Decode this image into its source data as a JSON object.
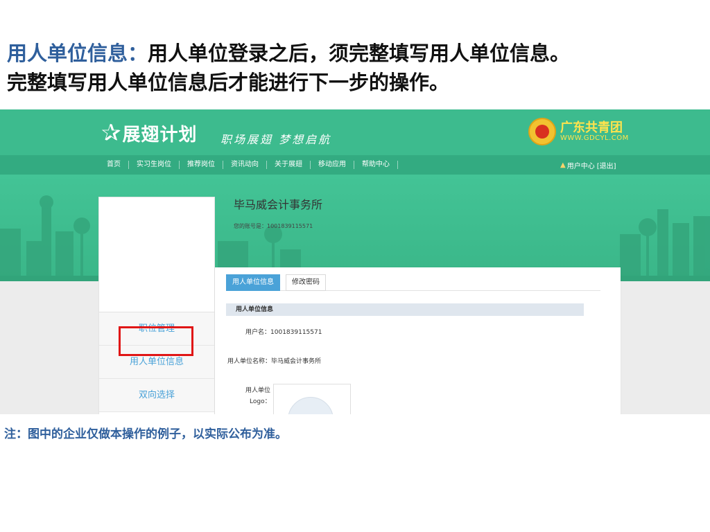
{
  "slide": {
    "title_highlight": "用人单位信息：",
    "title_rest": "用人单位登录之后，须完整填写用人单位信息。",
    "title_line2": "完整填写用人单位信息后才能进行下一步的操作。",
    "note": "注：图中的企业仅做本操作的例子，以实际公布为准。"
  },
  "site": {
    "logo_text": "展翅计划",
    "slogan": "职场展翅 梦想启航",
    "brand_cn": "广东共青团",
    "brand_en": "WWW.GDCYL.COM",
    "nav": [
      "首页",
      "实习生岗位",
      "推荐岗位",
      "资讯动向",
      "关于展翅",
      "移动应用",
      "帮助中心"
    ],
    "user_center": "用户中心",
    "logout": "[退出]"
  },
  "profile": {
    "company_name": "毕马威会计事务所",
    "account_label": "您的账号是：",
    "account_no": "1001839115571"
  },
  "sidebar": {
    "items": [
      "职位管理",
      "用人单位信息",
      "双向选择"
    ]
  },
  "tabs": {
    "items": [
      "用人单位信息",
      "修改密码"
    ]
  },
  "form": {
    "section_title": "用人单位信息",
    "username_label": "用户名：",
    "username_value": "1001839115571",
    "company_label": "用人单位名称：",
    "company_value": "毕马威会计事务所",
    "logo_label_1": "用人单位",
    "logo_label_2": "Logo："
  },
  "colors": {
    "header_green": "#3dbb8e",
    "nav_green": "#33ab81",
    "accent_blue": "#4aa2d8",
    "highlight_red": "#e01616",
    "title_blue": "#2f5f9c"
  }
}
